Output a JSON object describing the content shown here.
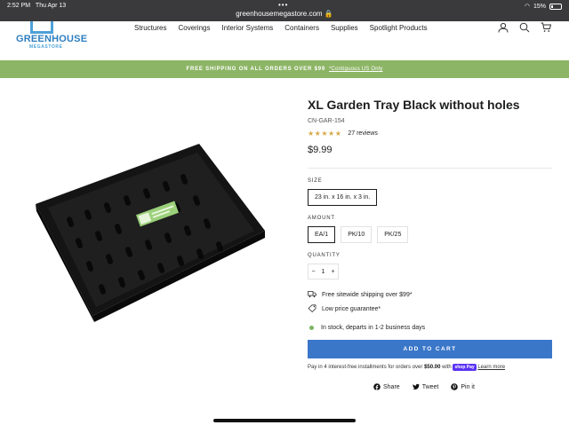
{
  "statusbar": {
    "time": "2:52 PM",
    "date": "Thu Apr 13",
    "dots": "•••",
    "url": "greenhousemegastore.com",
    "battery": "15%"
  },
  "header": {
    "logo_text": "GREENHOUSE",
    "logo_sub": "MEGASTORE",
    "nav": [
      "Structures",
      "Coverings",
      "Interior Systems",
      "Containers",
      "Supplies",
      "Spotlight Products"
    ]
  },
  "banner": {
    "text": "FREE SHIPPING ON ALL ORDERS OVER $99",
    "link": "*Contiguous US Only"
  },
  "product": {
    "title": "XL Garden Tray Black without holes",
    "sku": "CN-GAR-154",
    "stars": "★★★★★",
    "reviews": "27 reviews",
    "price": "$9.99",
    "size_label": "SIZE",
    "size_options": [
      "23 in. x 16 in. x 3 in."
    ],
    "amount_label": "AMOUNT",
    "amount_options": [
      "EA/1",
      "PK/10",
      "PK/25"
    ],
    "quantity_label": "QUANTITY",
    "quantity": {
      "minus": "−",
      "value": "1",
      "plus": "+"
    },
    "perks": [
      "Free sitewide shipping over $99*",
      "Low price guarantee*"
    ],
    "stock": "In stock, departs in 1-2 business days",
    "add_to_cart": "ADD TO CART",
    "installments": {
      "prefix": "Pay in 4 interest-free installments for orders over",
      "amount": "$50.00",
      "with": "with",
      "shoppay": "shop Pay",
      "learn": "Learn more"
    },
    "share": [
      "Share",
      "Tweet",
      "Pin it"
    ]
  },
  "colors": {
    "banner": "#8db566",
    "cart_button": "#3a77c9",
    "stars": "#d8a94a",
    "in_stock": "#7bb661"
  }
}
